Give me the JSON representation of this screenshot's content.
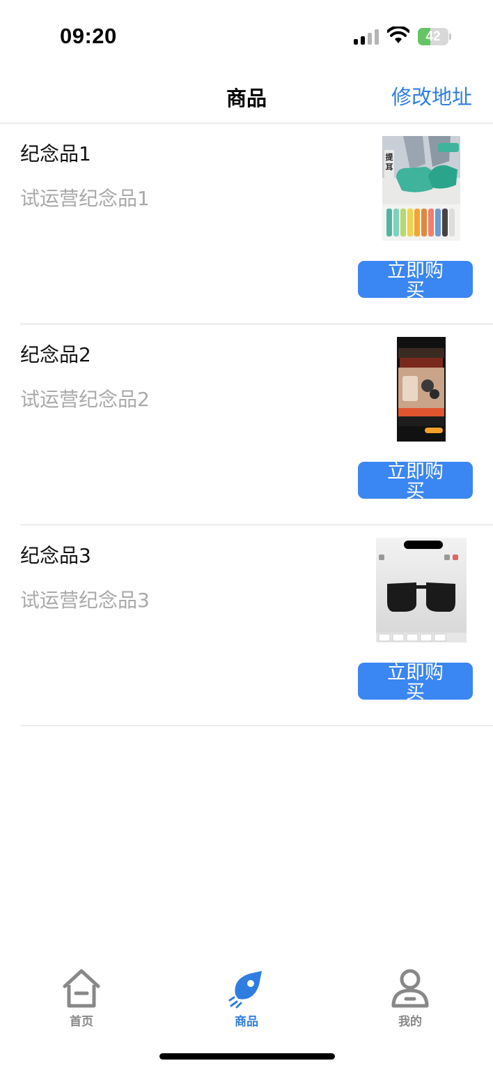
{
  "status_bar": {
    "time": "09:20",
    "battery_level": "42",
    "battery_fraction": 0.42,
    "signal_bars_active": 2,
    "icons": [
      "cellular-signal-icon",
      "wifi-icon",
      "battery-charging-icon"
    ]
  },
  "nav": {
    "title": "商品",
    "action": "修改地址",
    "accent_color": "#2f7de1"
  },
  "products": [
    {
      "name": "纪念品1",
      "description": "试运营纪念品1",
      "buy_label": "立即购买",
      "image": "socks-product-image"
    },
    {
      "name": "纪念品2",
      "description": "试运营纪念品2",
      "buy_label": "立即购买",
      "image": "phone-charger-product-image"
    },
    {
      "name": "纪念品3",
      "description": "试运营纪念品3",
      "buy_label": "立即购买",
      "image": "sunglasses-product-image"
    }
  ],
  "tab_bar": {
    "items": [
      {
        "label": "首页",
        "icon": "home-icon",
        "active": false
      },
      {
        "label": "商品",
        "icon": "rocket-icon",
        "active": true
      },
      {
        "label": "我的",
        "icon": "user-icon",
        "active": false
      }
    ],
    "active_color": "#2f7de1",
    "inactive_color": "#888888"
  },
  "colors": {
    "button": "#3a86f2",
    "divider": "#d9d9d9",
    "description_text": "#a9a9a9"
  }
}
